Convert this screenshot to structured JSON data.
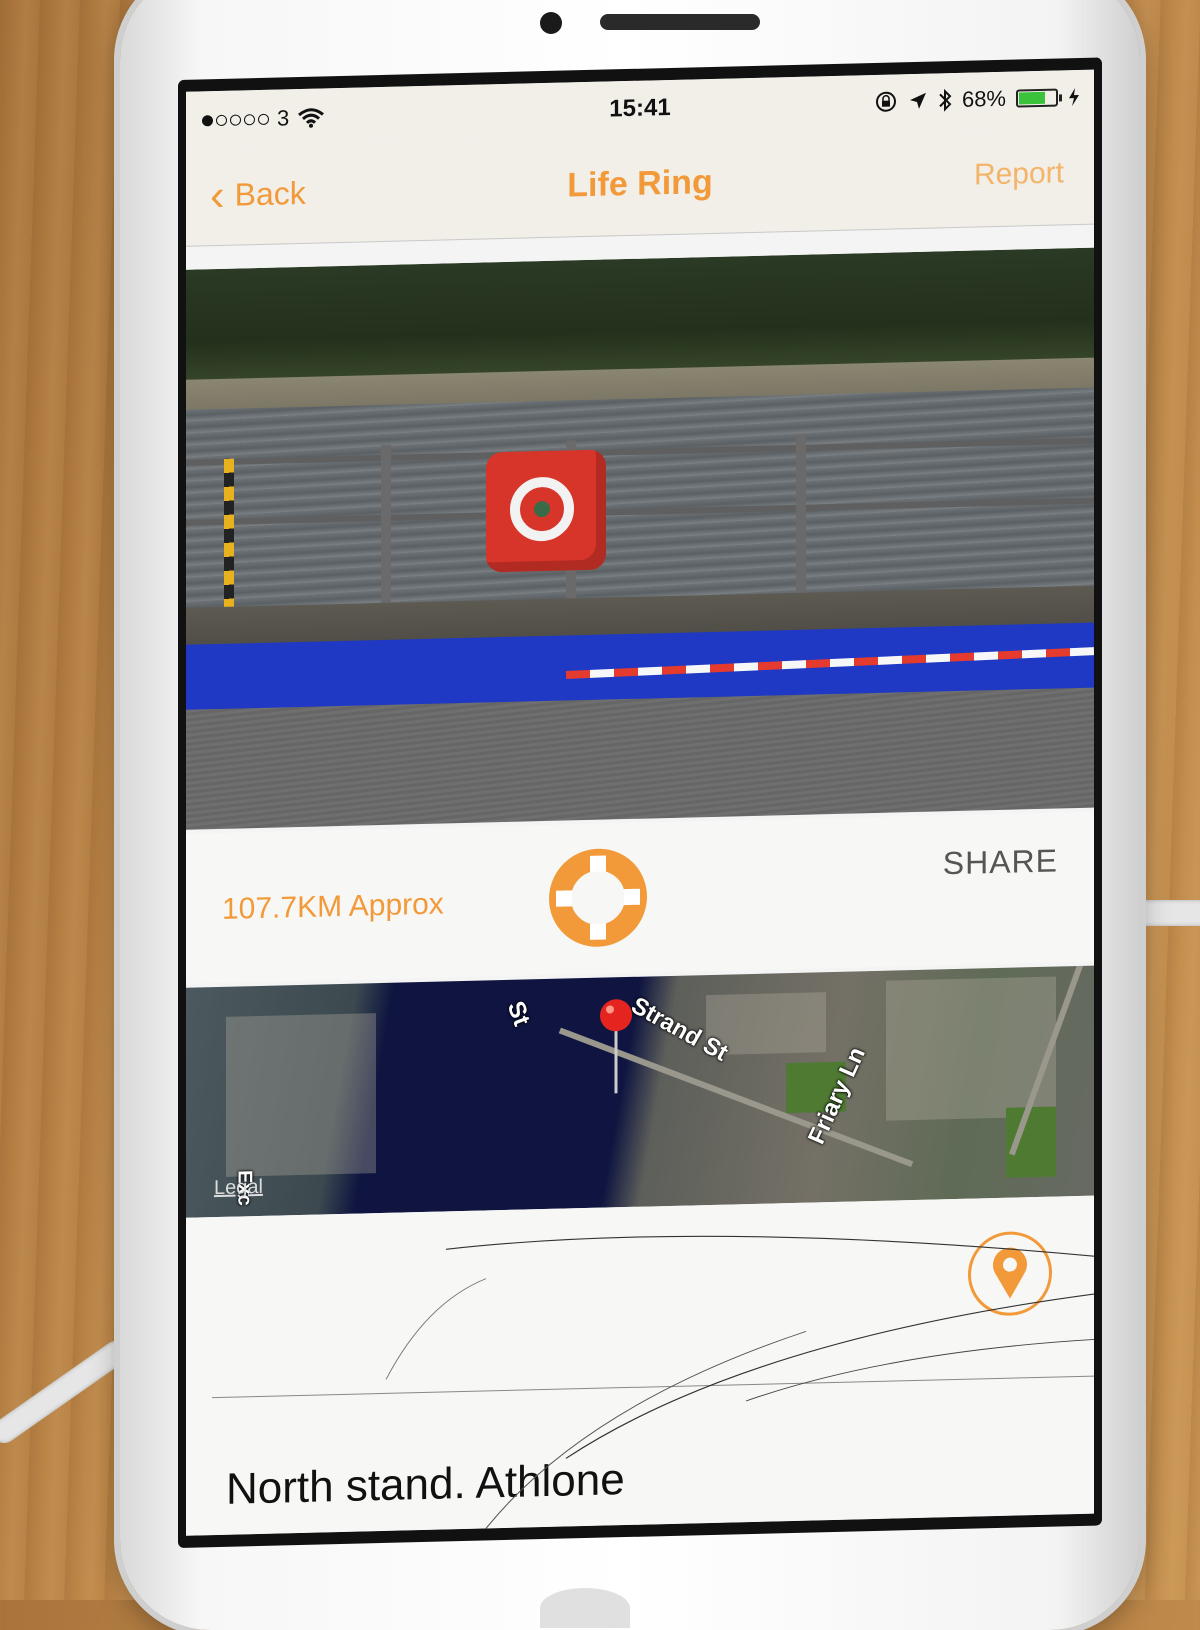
{
  "status_bar": {
    "carrier": "3",
    "time": "15:41",
    "battery_percent": "68%",
    "battery_level": 0.68
  },
  "navbar": {
    "back_label": "Back",
    "title": "Life Ring",
    "report_label": "Report"
  },
  "info": {
    "distance": "107.7KM Approx",
    "share_label": "SHARE"
  },
  "map": {
    "labels": [
      "Strand St",
      "Friary Ln",
      "St",
      "Exc"
    ],
    "legal": "Legal"
  },
  "details": {
    "address": "North stand. Athlone"
  },
  "colors": {
    "accent": "#f29a3a",
    "battery": "#39c23a"
  },
  "icons": [
    "back-chevron-icon",
    "wifi-icon",
    "lock-rotation-icon",
    "location-arrow-icon",
    "bluetooth-icon",
    "battery-icon",
    "charging-icon",
    "life-ring-icon",
    "map-pin-icon",
    "location-marker-icon"
  ]
}
